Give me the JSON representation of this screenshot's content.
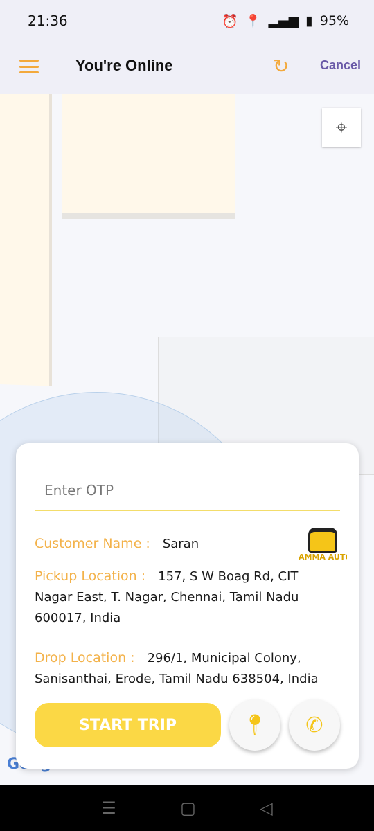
{
  "status_bar": {
    "time": "21:36",
    "battery": "95%",
    "icons": [
      "alarm-icon",
      "location-icon",
      "volte-icon",
      "signal-5g-icon",
      "signal-icon",
      "battery-icon"
    ]
  },
  "app_bar": {
    "title": "You're Online",
    "cancel_label": "Cancel",
    "menu_icon": "hamburger-icon",
    "refresh_icon": "refresh-icon"
  },
  "map": {
    "attribution": "Google"
  },
  "trip_card": {
    "otp_placeholder": "Enter OTP",
    "customer_label": "Customer Name :",
    "customer_name": "Saran",
    "pickup_label": "Pickup Location :",
    "pickup_address": "157, S W Boag Rd, CIT Nagar East, T. Nagar, Chennai, Tamil Nadu 600017, India",
    "drop_label": "Drop Location :",
    "drop_address": "296/1, Municipal Colony, Sanisanthai, Erode, Tamil Nadu 638504, India",
    "logo_text": "AMMA AUTO",
    "start_label": "START TRIP"
  },
  "colors": {
    "accent": "#f3a93c",
    "button": "#fbd845",
    "cancel": "#6a5aa8"
  }
}
